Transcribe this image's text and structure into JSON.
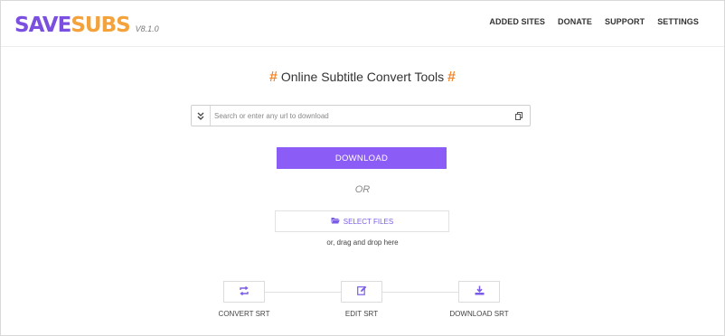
{
  "header": {
    "logo_prefix": "SAVE",
    "logo_suffix": "SUBS",
    "version": "V8.1.0",
    "nav": [
      "ADDED SITES",
      "DONATE",
      "SUPPORT",
      "SETTINGS"
    ]
  },
  "main": {
    "title_hash_left": "#",
    "title": "Online Subtitle Convert Tools",
    "title_hash_right": "#",
    "search_placeholder": "Search or enter any url to download",
    "download_label": "DOWNLOAD",
    "or_label": "OR",
    "select_files_label": "SELECT FILES",
    "drag_hint": "or, drag and drop here"
  },
  "steps": [
    {
      "label": "CONVERT SRT",
      "icon": "repeat-icon"
    },
    {
      "label": "EDIT SRT",
      "icon": "edit-icon"
    },
    {
      "label": "DOWNLOAD SRT",
      "icon": "download-icon"
    }
  ],
  "colors": {
    "accent": "#8b5cf6",
    "logo_purple": "#7b4fe0",
    "logo_orange": "#f4a23c",
    "hash_orange": "#f4862c"
  }
}
